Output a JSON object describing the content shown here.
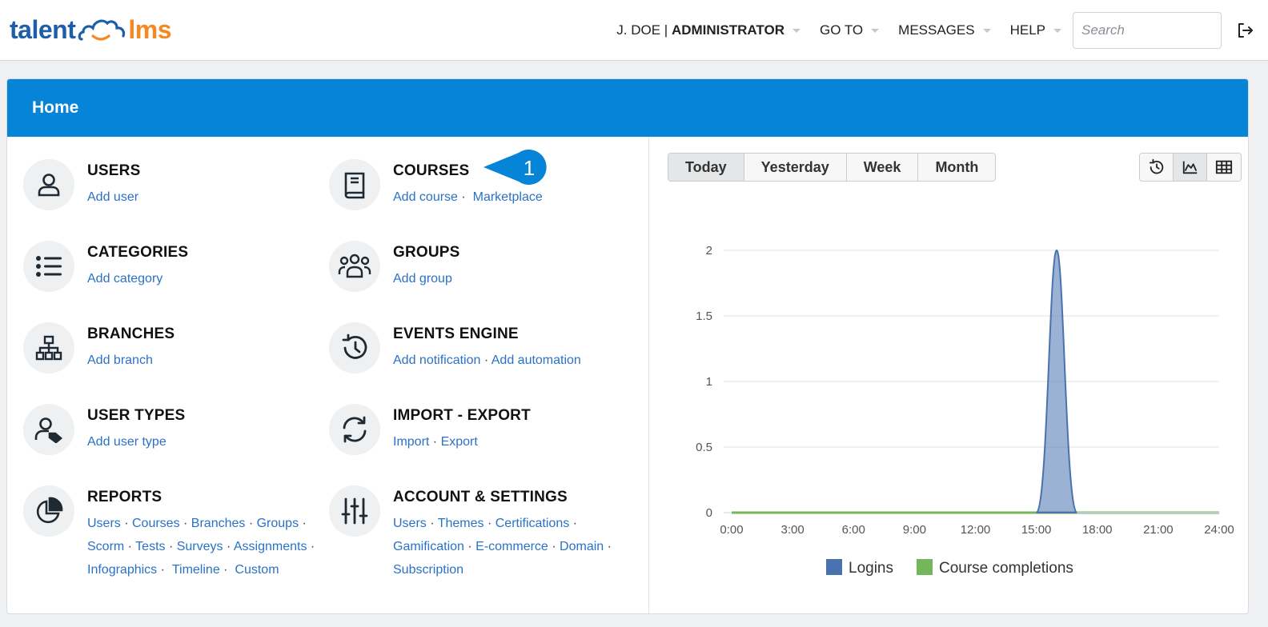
{
  "header": {
    "logo": {
      "part1": "talent",
      "part2": "lms"
    },
    "user": {
      "name": "J. DOE",
      "separator": "|",
      "role": "ADMINISTRATOR"
    },
    "nav": [
      "GO TO",
      "MESSAGES",
      "HELP"
    ],
    "search_placeholder": "Search"
  },
  "page": {
    "title": "Home"
  },
  "tiles": {
    "users": {
      "title": "USERS",
      "links": [
        "Add user"
      ]
    },
    "courses": {
      "title": "COURSES",
      "links": [
        "Add course",
        "Marketplace"
      ]
    },
    "categories": {
      "title": "CATEGORIES",
      "links": [
        "Add category"
      ]
    },
    "groups": {
      "title": "GROUPS",
      "links": [
        "Add group"
      ]
    },
    "branches": {
      "title": "BRANCHES",
      "links": [
        "Add branch"
      ]
    },
    "events": {
      "title": "EVENTS ENGINE",
      "links": [
        "Add notification",
        "Add automation"
      ]
    },
    "usertypes": {
      "title": "USER TYPES",
      "links": [
        "Add user type"
      ]
    },
    "importexport": {
      "title": "IMPORT - EXPORT",
      "links": [
        "Import",
        "Export"
      ]
    },
    "reports": {
      "title": "REPORTS",
      "links": [
        "Users",
        "Courses",
        "Branches",
        "Groups",
        "Scorm",
        "Tests",
        "Surveys",
        "Assignments",
        "Infographics",
        "Timeline",
        "Custom"
      ]
    },
    "account": {
      "title": "ACCOUNT & SETTINGS",
      "links": [
        "Users",
        "Themes",
        "Certifications",
        "Gamification",
        "E-commerce",
        "Domain",
        "Subscription"
      ]
    }
  },
  "callout": {
    "number": "1"
  },
  "period_tabs": [
    "Today",
    "Yesterday",
    "Week",
    "Month"
  ],
  "active_tab": "Today",
  "view_icons": [
    "history-icon",
    "area-chart-icon",
    "table-icon"
  ],
  "chart_data": {
    "type": "area",
    "x": [
      "0:00",
      "3:00",
      "6:00",
      "9:00",
      "12:00",
      "15:00",
      "18:00",
      "21:00",
      "24:00"
    ],
    "ylim": [
      0,
      2
    ],
    "yticks": [
      "0",
      "0.5",
      "1",
      "1.5",
      "2"
    ],
    "grid": true,
    "legend_position": "bottom",
    "series": [
      {
        "name": "Logins",
        "color": "#4a72b0",
        "points": [
          [
            0,
            0
          ],
          [
            15,
            0
          ],
          [
            16,
            2
          ],
          [
            17,
            0
          ],
          [
            24,
            0
          ]
        ]
      },
      {
        "name": "Course completions",
        "color": "#74b65a",
        "points": [
          [
            0,
            0
          ],
          [
            24,
            0
          ]
        ]
      }
    ]
  }
}
